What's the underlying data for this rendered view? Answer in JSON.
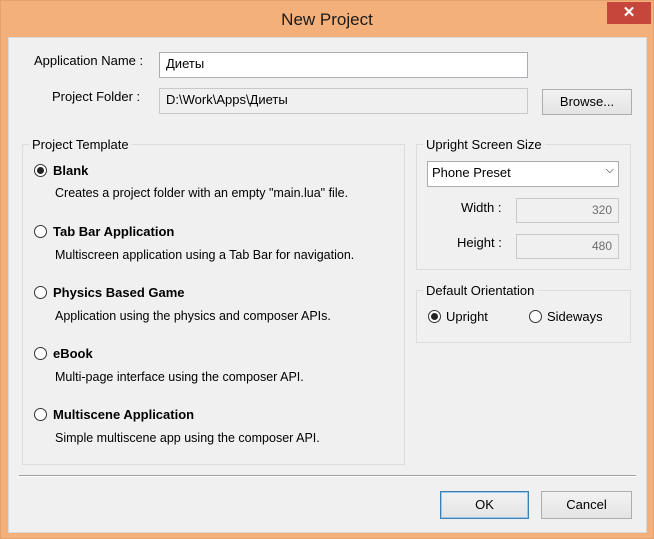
{
  "window": {
    "title": "New Project",
    "close_glyph": "✕"
  },
  "fields": {
    "app_name_label": "Application Name :",
    "app_name_value": "Диеты",
    "folder_label": "Project Folder :",
    "folder_value": "D:\\Work\\Apps\\Диеты",
    "browse_label": "Browse..."
  },
  "template_group": {
    "title": "Project Template",
    "options": [
      {
        "title": "Blank",
        "desc": "Creates a project folder with an empty \"main.lua\" file.",
        "selected": true
      },
      {
        "title": "Tab Bar Application",
        "desc": "Multiscreen application using a Tab Bar for navigation.",
        "selected": false
      },
      {
        "title": "Physics Based Game",
        "desc": "Application using the physics and composer APIs.",
        "selected": false
      },
      {
        "title": "eBook",
        "desc": "Multi-page interface using the composer API.",
        "selected": false
      },
      {
        "title": "Multiscene Application",
        "desc": "Simple multiscene app using the composer API.",
        "selected": false
      }
    ]
  },
  "screen_group": {
    "title": "Upright Screen Size",
    "preset": "Phone Preset",
    "width_label": "Width :",
    "width_value": "320",
    "height_label": "Height :",
    "height_value": "480"
  },
  "orientation_group": {
    "title": "Default Orientation",
    "upright": "Upright",
    "sideways": "Sideways",
    "selected": "Upright"
  },
  "buttons": {
    "ok": "OK",
    "cancel": "Cancel"
  }
}
